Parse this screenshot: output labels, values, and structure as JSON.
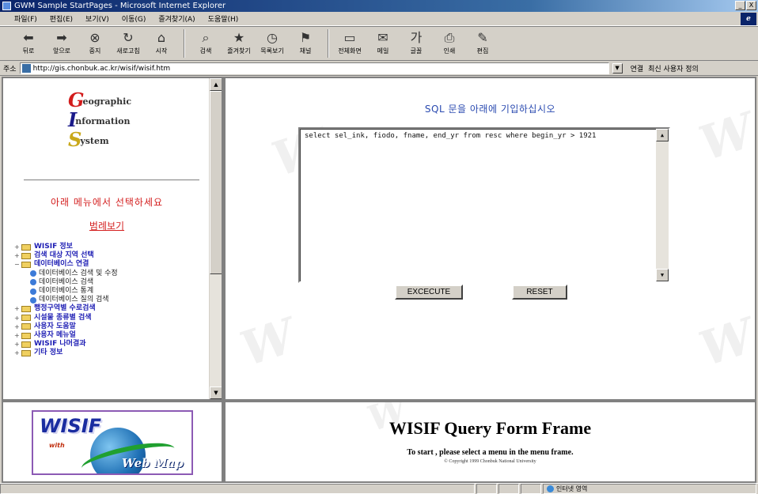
{
  "window": {
    "title": "GWM Sample StartPages - Microsoft Internet Explorer",
    "buttons": [
      "_",
      "X"
    ]
  },
  "menu": [
    "파일(F)",
    "편집(E)",
    "보기(V)",
    "이동(G)",
    "즐겨찾기(A)",
    "도움말(H)"
  ],
  "toolbar": [
    {
      "icon": "back-arrow-icon",
      "glyph": "⬅",
      "label": "뒤로"
    },
    {
      "icon": "forward-arrow-icon",
      "glyph": "➡",
      "label": "앞으로"
    },
    {
      "icon": "stop-icon",
      "glyph": "⊗",
      "label": "중지"
    },
    {
      "icon": "refresh-icon",
      "glyph": "↻",
      "label": "새로고침"
    },
    {
      "icon": "home-icon",
      "glyph": "⌂",
      "label": "시작"
    },
    {
      "icon": "search-icon",
      "glyph": "⌕",
      "label": "검색"
    },
    {
      "icon": "favorites-icon",
      "glyph": "★",
      "label": "즐겨찾기"
    },
    {
      "icon": "history-icon",
      "glyph": "◷",
      "label": "목록보기"
    },
    {
      "icon": "channels-icon",
      "glyph": "⚑",
      "label": "채널"
    },
    {
      "icon": "fullscreen-icon",
      "glyph": "▭",
      "label": "전체화면"
    },
    {
      "icon": "mail-icon",
      "glyph": "✉",
      "label": "메일"
    },
    {
      "icon": "font-icon",
      "glyph": "가",
      "label": "글꼴"
    },
    {
      "icon": "print-icon",
      "glyph": "⎙",
      "label": "인쇄"
    },
    {
      "icon": "edit-icon",
      "glyph": "✎",
      "label": "편집"
    }
  ],
  "address": {
    "label": "주소",
    "url": "http://gis.chonbuk.ac.kr/wisif/wisif.htm",
    "links": [
      "연결",
      "최신 사용자 정의"
    ]
  },
  "nav": {
    "logo": {
      "line1_cap": "G",
      "line1_rest": "eographic",
      "line2_cap": "I",
      "line2_rest": "nformation",
      "line3_cap": "S",
      "line3_rest": "ystem"
    },
    "prompt": "아래 메뉴에서 선택하세요",
    "legend_link": "범례보기",
    "tree": [
      {
        "label": "WISIF 정보",
        "level": 0,
        "expander": "+"
      },
      {
        "label": "검색 대상 지역 선택",
        "level": 0,
        "expander": "+"
      },
      {
        "label": "데이터베이스 연결",
        "level": 0,
        "expander": "−"
      },
      {
        "label": "데이터베이스 검색 및 수정",
        "level": 1,
        "expander": ""
      },
      {
        "label": "데이터베이스 검색",
        "level": 1,
        "expander": ""
      },
      {
        "label": "데이터베이스 통계",
        "level": 1,
        "expander": ""
      },
      {
        "label": "데이터베이스 질의 검색",
        "level": 1,
        "expander": ""
      },
      {
        "label": "행정구역별 수로검색",
        "level": 0,
        "expander": "+"
      },
      {
        "label": "시설물 종류별 검색",
        "level": 0,
        "expander": "+"
      },
      {
        "label": "사용자 도움말",
        "level": 0,
        "expander": "+"
      },
      {
        "label": "사용자 메뉴얼",
        "level": 0,
        "expander": "+"
      },
      {
        "label": "WISIF 나머결과",
        "level": 0,
        "expander": "+"
      },
      {
        "label": "기타 정보",
        "level": 0,
        "expander": "+"
      }
    ]
  },
  "main": {
    "prompt": "SQL 문을 아래에 기입하십시오",
    "sql_value": "select sel_ink, fiodo, fname, end_yr from resc where begin_yr > 1921",
    "execute_label": "EXCECUTE",
    "reset_label": "RESET"
  },
  "logo_frame": {
    "wisif": "WISIF",
    "with": "with",
    "webmap": "Web Map"
  },
  "bottom": {
    "title": "WISIF Query Form Frame",
    "subtitle": "To start , please select a menu in the menu frame.",
    "copyright": "© Copyright 1999 Chonbuk National University"
  },
  "status": {
    "zone": "인터넷 영역"
  }
}
